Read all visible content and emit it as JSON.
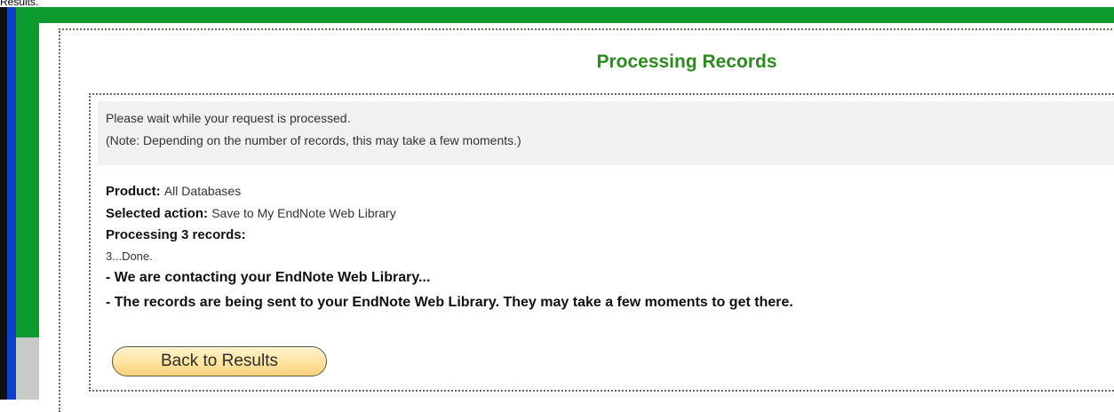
{
  "page": {
    "caption": "Results."
  },
  "colors": {
    "frame_blue": "#1040c8",
    "frame_green": "#0b9a2d",
    "title_green": "#2d8a1f",
    "button_fill": "#ffe4a0"
  },
  "dialog": {
    "title": "Processing Records",
    "note_line_1": "Please wait while your request is processed.",
    "note_line_2": "(Note: Depending on the number of records, this may take a few moments.)",
    "product_label": "Product:",
    "product_value": "All Databases",
    "action_label": "Selected action:",
    "action_value": "Save to My EndNote Web Library",
    "processing_label": "Processing 3 records:",
    "progress_text": "3...Done.",
    "status_1": "- We are contacting your EndNote Web Library...",
    "status_2": "- The records are being sent to your EndNote Web Library. They may take a few moments to get there.",
    "back_button_label": "Back to Results"
  }
}
